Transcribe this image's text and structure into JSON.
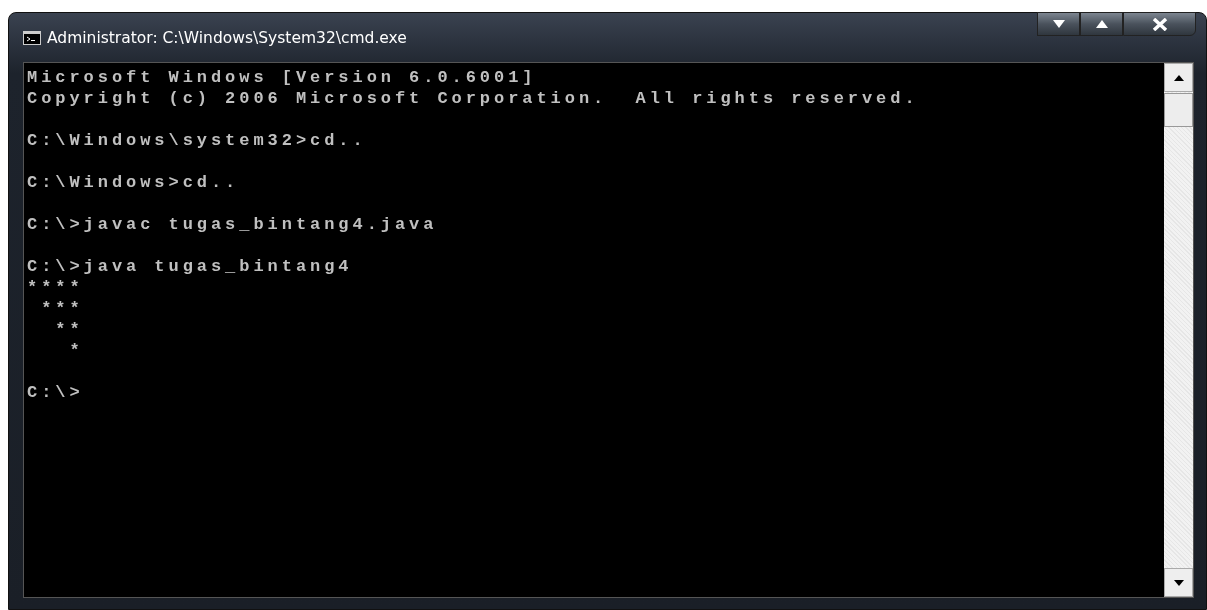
{
  "window": {
    "title": "Administrator: C:\\Windows\\System32\\cmd.exe"
  },
  "console": {
    "blocks": [
      {
        "lines": [
          "Microsoft Windows [Version 6.0.6001]",
          "Copyright (c) 2006 Microsoft Corporation.  All rights reserved."
        ]
      },
      {
        "lines": [
          "C:\\Windows\\system32>cd.."
        ]
      },
      {
        "lines": [
          "C:\\Windows>cd.."
        ]
      },
      {
        "lines": [
          "C:\\>javac tugas_bintang4.java"
        ]
      },
      {
        "lines": [
          "C:\\>java tugas_bintang4",
          "****",
          " ***",
          "  **",
          "   *"
        ]
      },
      {
        "lines": [
          "C:\\>"
        ]
      }
    ]
  }
}
